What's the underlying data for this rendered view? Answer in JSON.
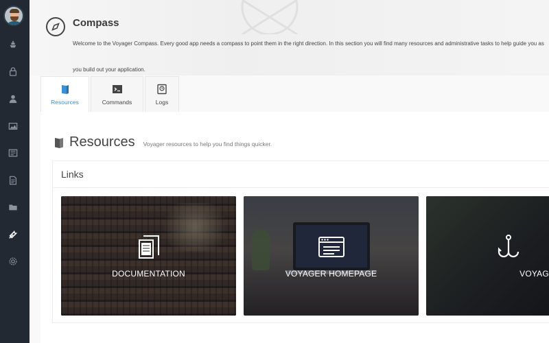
{
  "header": {
    "title": "Compass",
    "description": "Welcome to the Voyager Compass. Every good app needs a compass to point them in the right direction. In this section you will find many resources and administrative tasks to help guide you as you build out your application."
  },
  "tabs": [
    {
      "label": "Resources",
      "active": true,
      "icon": "book-icon"
    },
    {
      "label": "Commands",
      "active": false,
      "icon": "terminal-icon"
    },
    {
      "label": "Logs",
      "active": false,
      "icon": "log-icon"
    }
  ],
  "resources": {
    "title": "Resources",
    "subtitle": "Voyager resources to help you find things quicker."
  },
  "links": {
    "title": "Links",
    "cards": [
      {
        "label": "DOCUMENTATION",
        "icon": "documents-icon"
      },
      {
        "label": "VOYAGER HOMEPAGE",
        "icon": "browser-icon"
      },
      {
        "label": "VOYAGER HOOKS",
        "icon": "hook-icon"
      }
    ]
  },
  "sidebar": {
    "icons": [
      "boat-icon",
      "lock-icon",
      "user-icon",
      "image-icon",
      "news-icon",
      "document-icon",
      "folder-icon",
      "tools-icon",
      "gear-icon"
    ]
  },
  "colors": {
    "sidebar": "#222933",
    "accent": "#3a8fd5"
  }
}
